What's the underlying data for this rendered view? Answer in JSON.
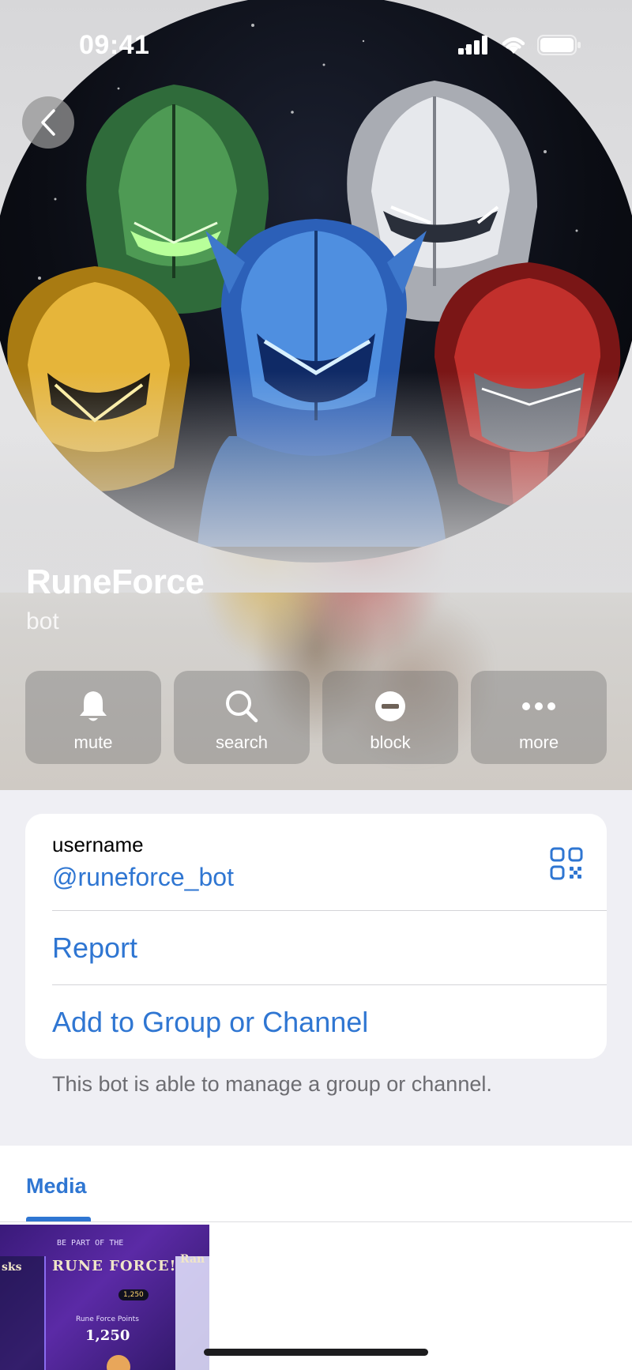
{
  "status_bar": {
    "time": "09:41"
  },
  "profile": {
    "name": "RuneForce",
    "subtitle": "bot"
  },
  "actions": [
    {
      "id": "mute",
      "label": "mute",
      "icon": "bell-icon"
    },
    {
      "id": "search",
      "label": "search",
      "icon": "search-icon"
    },
    {
      "id": "block",
      "label": "block",
      "icon": "block-icon"
    },
    {
      "id": "more",
      "label": "more",
      "icon": "more-icon"
    }
  ],
  "info": {
    "username_label": "username",
    "username_value": "@runeforce_bot",
    "report_label": "Report",
    "add_label": "Add to Group or Channel",
    "footnote": "This bot is able to manage a group or channel."
  },
  "media": {
    "tab_label": "Media",
    "thumbnail": {
      "title": "RUNE FORCE!",
      "caption": "BE PART OF THE",
      "points_label": "Rune Force Points",
      "points": "1,250",
      "side_left": "sks",
      "side_right": "Ran",
      "badge": "1,250"
    }
  },
  "colors": {
    "accent": "#2f76d2",
    "secondary_text": "#6d6d72",
    "background": "#efeff4"
  }
}
